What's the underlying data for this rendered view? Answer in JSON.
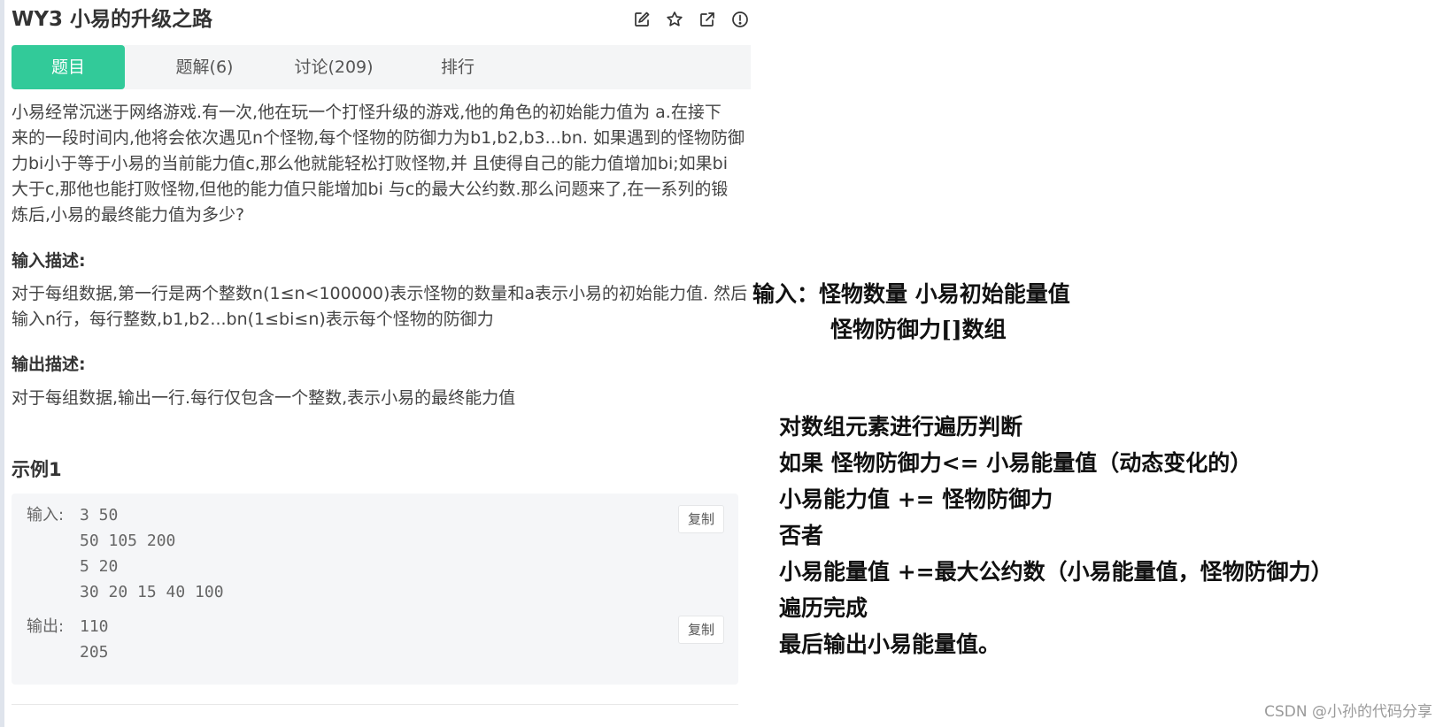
{
  "header": {
    "title": "WY3  小易的升级之路",
    "icons": [
      "edit-icon",
      "star-icon",
      "external-link-icon",
      "report-icon"
    ]
  },
  "tabs": [
    {
      "label": "题目",
      "active": true
    },
    {
      "label": "题解(6)",
      "active": false
    },
    {
      "label": "讨论(209)",
      "active": false
    },
    {
      "label": "排行",
      "active": false
    }
  ],
  "problem": {
    "description_lines": [
      "小易经常沉迷于网络游戏.有一次,他在玩一个打怪升级的游戏,他的角色的初始能力值为 a.在接下",
      "来的一段时间内,他将会依次遇见n个怪物,每个怪物的防御力为b1,b2,b3...bn. 如果遇到的怪物防御",
      "力bi小于等于小易的当前能力值c,那么他就能轻松打败怪物,并 且使得自己的能力值增加bi;如果bi",
      "大于c,那他也能打败怪物,但他的能力值只能增加bi 与c的最大公约数.那么问题来了,在一系列的锻",
      "炼后,小易的最终能力值为多少?"
    ],
    "input_title": "输入描述:",
    "input_lines": [
      "对于每组数据,第一行是两个整数n(1≤n<100000)表示怪物的数量和a表示小易的初始能力值. 然后",
      "输入n行，每行整数,b1,b2...bn(1≤bi≤n)表示每个怪物的防御力"
    ],
    "output_title": "输出描述:",
    "output_text": "对于每组数据,输出一行.每行仅包含一个整数,表示小易的最终能力值"
  },
  "example": {
    "title": "示例1",
    "input_label": "输入:",
    "input_lines": [
      "3 50",
      "50 105 200",
      "5 20",
      "30 20 15 40 100"
    ],
    "output_label": "输出:",
    "output_lines": [
      "110",
      "205"
    ],
    "copy_label": "复制"
  },
  "notes": {
    "lines": [
      "输入：怪物数量 小易初始能量值",
      "怪物防御力[]数组",
      "对数组元素进行遍历判断",
      "如果 怪物防御力<= 小易能量值（动态变化的）",
      "小易能力值 += 怪物防御力",
      "否者",
      "小易能量值 +=最大公约数（小易能量值，怪物防御力）",
      "遍历完成",
      "最后输出小易能量值。"
    ]
  },
  "watermark": "CSDN @小孙的代码分享",
  "colors": {
    "accent": "#32ca99",
    "tab_bar_bg": "#f4f5f6",
    "example_bg": "#f5f6f8"
  }
}
